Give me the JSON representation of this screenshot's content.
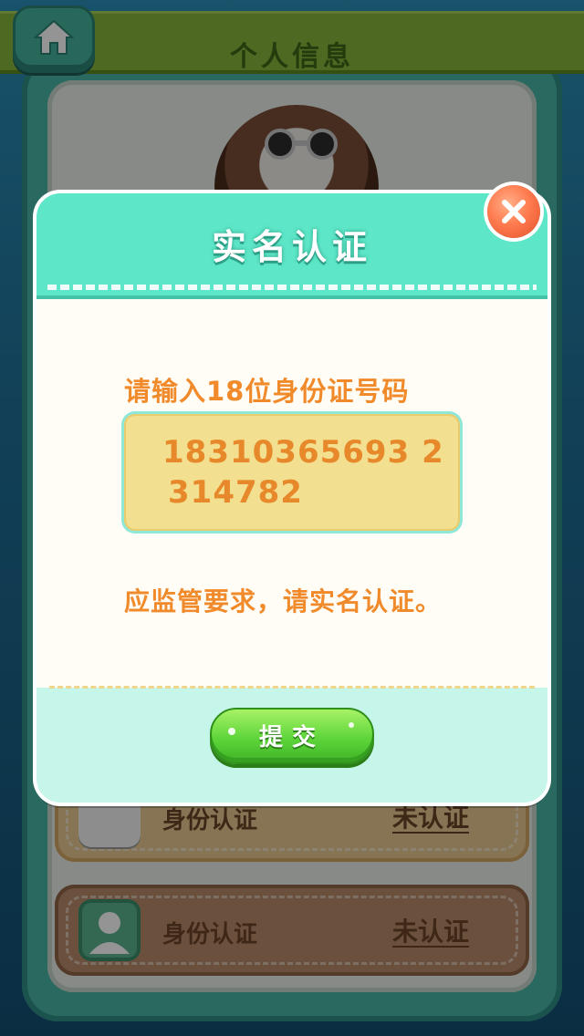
{
  "background": {
    "header_title": "个人信息",
    "cards": [
      {
        "label": "身份认证",
        "status": "未认证"
      },
      {
        "label": "身份认证",
        "status": "未认证"
      }
    ]
  },
  "modal": {
    "title": "实名认证",
    "prompt": "请输入18位身份证号码",
    "id_input": {
      "line1": "18310365693 2",
      "line2": "314782"
    },
    "notice": "应监管要求，请实名认证。",
    "submit_label": "提交"
  }
}
